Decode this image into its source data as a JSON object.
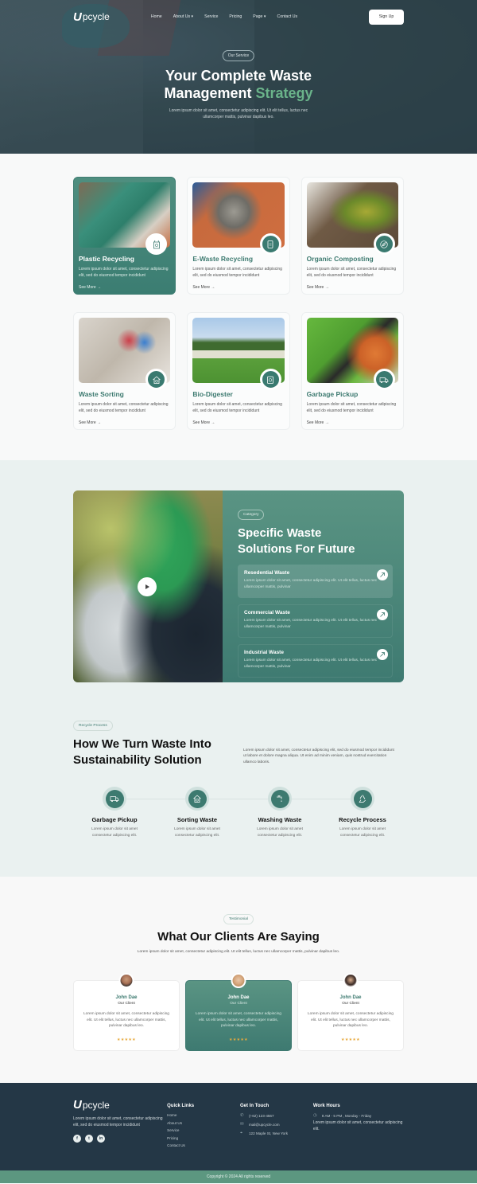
{
  "colors": {
    "brand": "#3d7a70",
    "accent_green": "#6ab38a",
    "footer_bg": "#243746",
    "copyright_bg": "#5c9780",
    "star": "#e7a93c"
  },
  "nav": {
    "logo_letter": "U",
    "logo_text": "pcycle",
    "links": [
      {
        "label": "Home",
        "dropdown": false
      },
      {
        "label": "About Us",
        "dropdown": true
      },
      {
        "label": "Service",
        "dropdown": false
      },
      {
        "label": "Pricing",
        "dropdown": false
      },
      {
        "label": "Page",
        "dropdown": true
      },
      {
        "label": "Contact Us",
        "dropdown": false
      }
    ],
    "signup_label": "Sign Up"
  },
  "hero": {
    "badge": "Our Service",
    "title_line1": "Your Complete Waste",
    "title_line2_plain": "Management ",
    "title_line2_accent": "Strategy",
    "subtitle_line1": "Lorem ipsum dolor sit amet, consectetur adipiscing elit. Ut elit tellus, luctus nec",
    "subtitle_line2": "ullamcorper mattis, pulvinar dapibus leo."
  },
  "services": [
    {
      "title": "Plastic Recycling",
      "desc": "Lorem ipsum dolor sit amet, consectetur adipiscing elit, sed do eiusmod tempor incididunt",
      "more": "See More",
      "icon": "plastic-bag-icon",
      "active": true
    },
    {
      "title": "E-Waste Recycling",
      "desc": "Lorem ipsum dolor sit amet, consectetur adipiscing elit, sed do eiusmod tempor incididunt",
      "more": "See More",
      "icon": "phone-device-icon",
      "active": false
    },
    {
      "title": "Organic Composting",
      "desc": "Lorem ipsum dolor sit amet, consectetur adipiscing elit, sed do eiusmod tempor incididunt",
      "more": "See More",
      "icon": "leaf-icon",
      "active": false
    },
    {
      "title": "Waste Sorting",
      "desc": "Lorem ipsum dolor sit amet, consectetur adipiscing elit, sed do eiusmod tempor incididunt",
      "more": "See More",
      "icon": "house-recycle-icon",
      "active": false
    },
    {
      "title": "Bio-Digester",
      "desc": "Lorem ipsum dolor sit amet, consectetur adipiscing elit, sed do eiusmod tempor incididunt",
      "more": "See More",
      "icon": "digester-bin-icon",
      "active": false
    },
    {
      "title": "Garbage Pickup",
      "desc": "Lorem ipsum dolor sit amet, consectetur adipiscing elit, sed do eiusmod tempor incididunt",
      "more": "See More",
      "icon": "truck-icon",
      "active": false
    }
  ],
  "category": {
    "badge": "Category",
    "title_line1": "Specific Waste",
    "title_line2": "Solutions For Future",
    "items": [
      {
        "title": "Resedential Waste",
        "desc": "Lorem ipsum dolor sit amet, consectetur adipiscing elit. Ut elit tellus, luctus nec ullamcorper mattis, pulvinar",
        "active": true
      },
      {
        "title": "Commercial Waste",
        "desc": "Lorem ipsum dolor sit amet, consectetur adipiscing elit. Ut elit tellus, luctus nec ullamcorper mattis, pulvinar",
        "active": false
      },
      {
        "title": "Industrial Waste",
        "desc": "Lorem ipsum dolor sit amet, consectetur adipiscing elit. Ut elit tellus, luctus nec ullamcorper mattis, pulvinar",
        "active": false
      }
    ]
  },
  "process": {
    "badge": "Recycle Process",
    "title_line1": "How We Turn Waste Into",
    "title_line2": "Sustainability Solution",
    "desc": "Lorem ipsum dolor sit amet, consectetur adipiscing elit, sed do eiusmod tempor incididunt ut labore et dolore magna aliqua. Ut enim ad minim veniam, quis nostrud exercitation ullamco laboris.",
    "steps": [
      {
        "title": "Garbage Pickup",
        "desc_line1": "Lorem ipsum dolor sit amet",
        "desc_line2": "consectetur adipiscing elit.",
        "icon": "truck-icon"
      },
      {
        "title": "Sorting Waste",
        "desc_line1": "Lorem ipsum dolor sit amet",
        "desc_line2": "consectetur adipiscing elit.",
        "icon": "house-recycle-icon"
      },
      {
        "title": "Washing Waste",
        "desc_line1": "Lorem ipsum dolor sit amet",
        "desc_line2": "consectetur adipiscing elit.",
        "icon": "faucet-icon"
      },
      {
        "title": "Recycle Process",
        "desc_line1": "Lorem ipsum dolor sit amet",
        "desc_line2": "consectetur adipiscing elit.",
        "icon": "recycle-icon"
      }
    ]
  },
  "testimonials": {
    "badge": "Testimonial",
    "title": "What Our Clients Are Saying",
    "subtitle": "Lorem ipsum dolor sit amet, consectetur adipiscing elit. Ut elit tellus, luctus nec ullamcorper mattis, pulvinar dapibus leo.",
    "items": [
      {
        "name": "John Dae",
        "role": "Our Client",
        "text": "Lorem ipsum dolor sit amet, consectetur adipiscing elit. Ut elit tellus, luctus nec ullamcorper mattis, pulvinar dapibus leo.",
        "rating": 5,
        "stars": "★★★★★",
        "active": false
      },
      {
        "name": "John Dae",
        "role": "Our Client",
        "text": "Lorem ipsum dolor sit amet, consectetur adipiscing elit. Ut elit tellus, luctus nec ullamcorper mattis, pulvinar dapibus leo.",
        "rating": 5,
        "stars": "★★★★★",
        "active": true
      },
      {
        "name": "John Dae",
        "role": "Our Client",
        "text": "Lorem ipsum dolor sit amet, consectetur adipiscing elit. Ut elit tellus, luctus nec ullamcorper mattis, pulvinar dapibus leo.",
        "rating": 5,
        "stars": "★★★★★",
        "active": false
      }
    ]
  },
  "footer": {
    "logo_letter": "U",
    "logo_text": "pcycle",
    "about": "Lorem ipsum dolor sit amet, consectetur adipiscing elit, sed do eiusmod tempor incididunt",
    "social": [
      {
        "icon": "facebook-icon",
        "glyph": "f"
      },
      {
        "icon": "twitter-icon",
        "glyph": "t"
      },
      {
        "icon": "linkedin-icon",
        "glyph": "in"
      }
    ],
    "quick_links_title": "Quick Links",
    "quick_links": [
      "Home",
      "About Us",
      "Service",
      "Pricing",
      "Contact Us"
    ],
    "contact_title": "Get In Touch",
    "phone": "(+62) 123-4567",
    "email": "mail@upcycle.com",
    "address": "122 Maple St, New York",
    "hours_title": "Work Hours",
    "hours": "8 AM - 5 PM , Monday - Friday",
    "hours_desc": "Lorem ipsum dolor sit amet, consectetur adipiscing elit.",
    "copyright": "Copyright © 2024 All rights reserved"
  }
}
